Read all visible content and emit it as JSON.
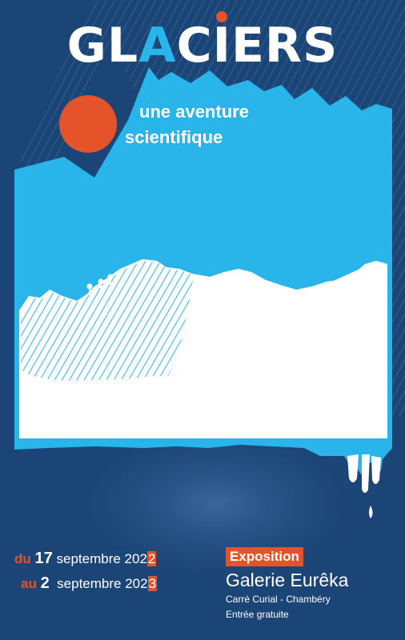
{
  "poster": {
    "title": {
      "prefix": "GL",
      "highlight": "A",
      "middle": "C",
      "dotted_letter": "I",
      "suffix": "ERS"
    },
    "subtitle": {
      "line1": "une aventure",
      "line2": "scientifique"
    },
    "dates": {
      "from": {
        "prefix": "du",
        "day": "17",
        "month_year_head": "septembre 202",
        "year_last_digit": "2"
      },
      "to": {
        "prefix": "au",
        "day": "2",
        "month_year_head": "septembre 202",
        "year_last_digit": "3"
      }
    },
    "venue": {
      "tag": "Exposition",
      "name": "Galerie Eurêka",
      "location": "Carré Curial - Chambéry",
      "admission": "Entrée gratuite"
    },
    "colors": {
      "background": "#1c4577",
      "accent_orange": "#e4532a",
      "ice_blue": "#29b5ea",
      "white": "#ffffff"
    },
    "icons": [
      "sun-circle",
      "mountain-silhouette",
      "climbers-silhouette",
      "melting-drips"
    ]
  }
}
